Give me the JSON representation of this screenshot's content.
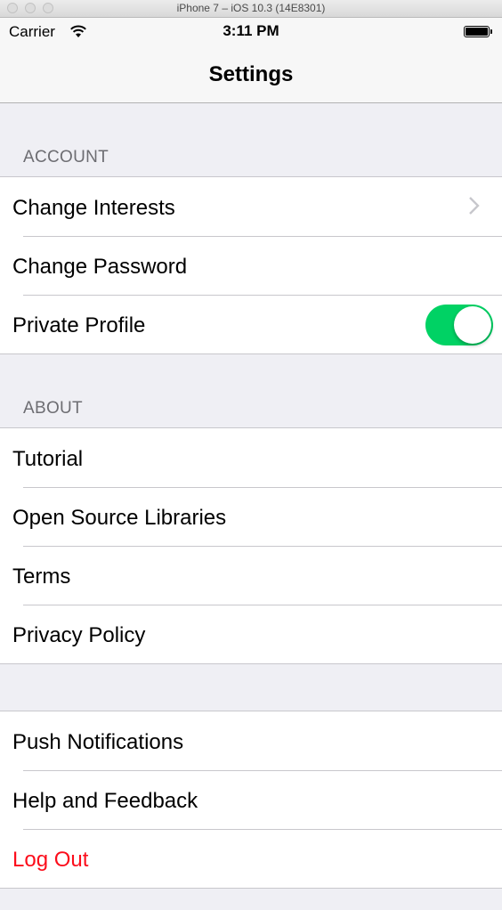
{
  "window": {
    "title": "iPhone 7 – iOS 10.3 (14E8301)"
  },
  "status_bar": {
    "carrier": "Carrier",
    "time": "3:11 PM"
  },
  "nav": {
    "title": "Settings"
  },
  "sections": {
    "account": {
      "header": "ACCOUNT",
      "items": [
        {
          "label": "Change Interests"
        },
        {
          "label": "Change Password"
        },
        {
          "label": "Private Profile",
          "toggle": true
        }
      ]
    },
    "about": {
      "header": "ABOUT",
      "items": [
        {
          "label": "Tutorial"
        },
        {
          "label": "Open Source Libraries"
        },
        {
          "label": "Terms"
        },
        {
          "label": "Privacy Policy"
        }
      ]
    },
    "other": {
      "items": [
        {
          "label": "Push Notifications"
        },
        {
          "label": "Help and Feedback"
        },
        {
          "label": "Log Out"
        }
      ]
    }
  },
  "colors": {
    "toggle_on": "#00d264",
    "destructive": "#fc0d1b",
    "group_background": "#efeff4"
  },
  "icons": [
    "wifi-icon",
    "battery-icon",
    "chevron-right-icon"
  ]
}
